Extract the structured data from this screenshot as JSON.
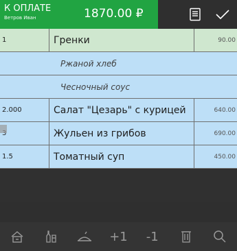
{
  "header": {
    "pay_label": "К ОПЛАТЕ",
    "customer": "Ветров Иван",
    "amount": "1870.00 ₽",
    "icons": [
      "receipt-icon",
      "check-icon"
    ]
  },
  "rows": [
    {
      "type": "selected",
      "qty": "1",
      "name": "Гренки",
      "price": "90.00"
    },
    {
      "type": "modifier",
      "name": "Ржаной хлеб"
    },
    {
      "type": "modifier",
      "name": "Чесночный соус"
    },
    {
      "type": "item",
      "qty": "2.000",
      "name": "Салат \"Цезарь\" с курицей",
      "price": "640.00"
    },
    {
      "type": "item",
      "qty": "3",
      "name": "Жульен из грибов",
      "price": "690.00"
    },
    {
      "type": "item",
      "qty": "1.5",
      "name": "Томатный суп",
      "price": "450.00"
    }
  ],
  "toolbar": {
    "plus_label": "+1",
    "minus_label": "-1",
    "icons": [
      "home-icon",
      "bottles-icon",
      "dish-icon",
      "plus-one",
      "minus-one",
      "trash-icon",
      "search-icon"
    ]
  }
}
